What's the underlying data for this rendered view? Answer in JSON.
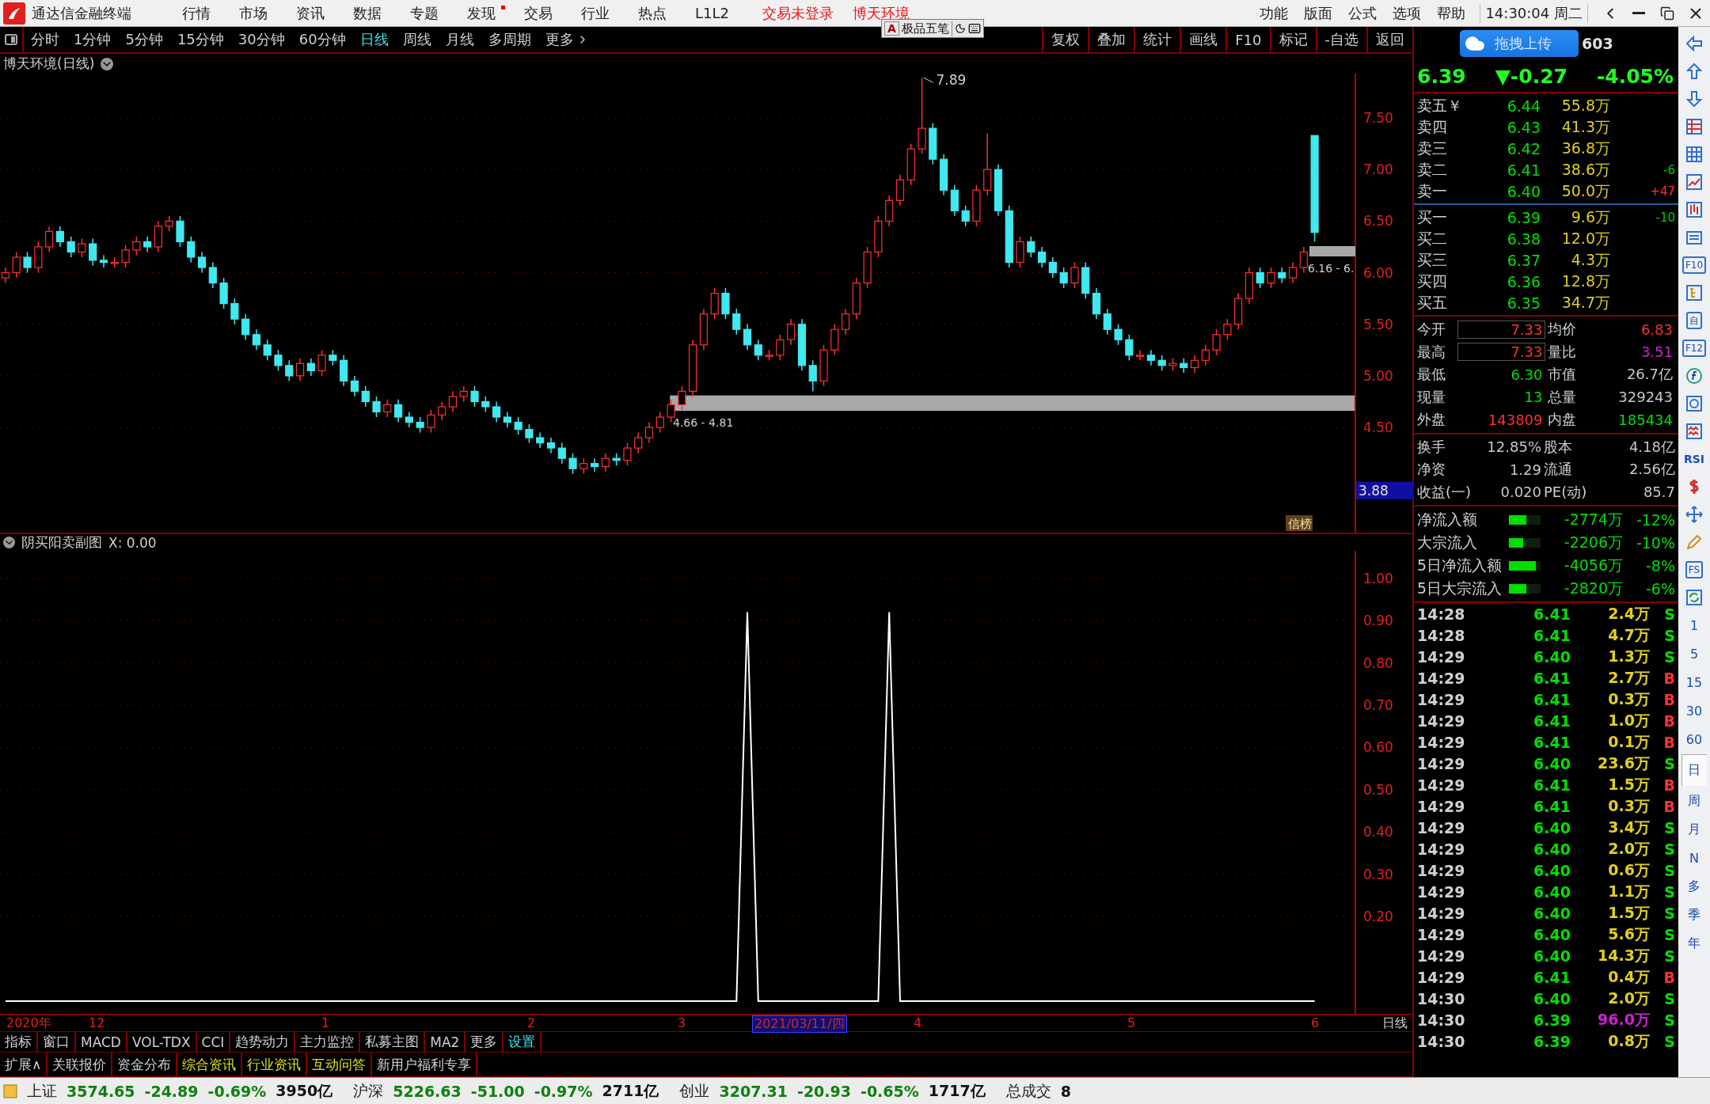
{
  "app": {
    "title": "通达信金融终端",
    "menu": [
      {
        "label": "行情",
        "dot": false
      },
      {
        "label": "市场",
        "dot": false
      },
      {
        "label": "资讯",
        "dot": false
      },
      {
        "label": "数据",
        "dot": false
      },
      {
        "label": "专题",
        "dot": false
      },
      {
        "label": "发现",
        "dot": true
      },
      {
        "label": "交易",
        "dot": false
      },
      {
        "label": "行业",
        "dot": false
      },
      {
        "label": "热点",
        "dot": false
      },
      {
        "label": "L1L2",
        "dot": false
      }
    ],
    "notices": [
      "交易未登录",
      "博天环境"
    ],
    "menu_right": [
      "功能",
      "版面",
      "公式",
      "选项",
      "帮助"
    ],
    "clock": "14:30:04 周二"
  },
  "ime_bar": {
    "mode": "A",
    "name": "极品五笔"
  },
  "periods": [
    {
      "label": "分时",
      "selected": false
    },
    {
      "label": "1分钟",
      "selected": false
    },
    {
      "label": "5分钟",
      "selected": false
    },
    {
      "label": "15分钟",
      "selected": false
    },
    {
      "label": "30分钟",
      "selected": false
    },
    {
      "label": "60分钟",
      "selected": false
    },
    {
      "label": "日线",
      "selected": true
    },
    {
      "label": "周线",
      "selected": false
    },
    {
      "label": "月线",
      "selected": false
    },
    {
      "label": "多周期",
      "selected": false
    },
    {
      "label": "更多",
      "selected": false
    }
  ],
  "tools": [
    "复权",
    "叠加",
    "统计",
    "画线",
    "F10",
    "标记",
    "-自选",
    "返回"
  ],
  "chart": {
    "title": "博天环境(日线)",
    "high_label": "7.89",
    "low_label": "3.88",
    "chart_data": {
      "type": "candlestick",
      "ylim": [
        3.48,
        7.93
      ],
      "grid": true,
      "bands": [
        {
          "axis": "y",
          "from": 4.66,
          "to": 4.81,
          "label": "4.66 - 4.81"
        }
      ],
      "yticks": [
        {
          "value": 7.5,
          "label": "7.50"
        },
        {
          "value": 7.0,
          "label": "7.00"
        },
        {
          "value": 6.5,
          "label": "6.50"
        },
        {
          "value": 6.0,
          "label": "6.00"
        },
        {
          "value": 5.5,
          "label": "5.50"
        },
        {
          "value": 5.0,
          "label": "5.00"
        },
        {
          "value": 4.5,
          "label": "4.50"
        }
      ],
      "ohlc": [
        [
          5.95,
          6.05,
          5.9,
          6.0
        ],
        [
          6.0,
          6.2,
          5.95,
          6.15
        ],
        [
          6.15,
          6.2,
          6.0,
          6.05
        ],
        [
          6.05,
          6.3,
          6.0,
          6.25
        ],
        [
          6.25,
          6.45,
          6.2,
          6.4
        ],
        [
          6.4,
          6.45,
          6.25,
          6.3
        ],
        [
          6.3,
          6.35,
          6.15,
          6.2
        ],
        [
          6.2,
          6.33,
          6.15,
          6.28
        ],
        [
          6.28,
          6.33,
          6.07,
          6.12
        ],
        [
          6.12,
          6.17,
          6.05,
          6.1
        ],
        [
          6.1,
          6.15,
          6.05,
          6.1
        ],
        [
          6.1,
          6.27,
          6.05,
          6.22
        ],
        [
          6.22,
          6.35,
          6.17,
          6.3
        ],
        [
          6.3,
          6.35,
          6.2,
          6.25
        ],
        [
          6.25,
          6.5,
          6.2,
          6.45
        ],
        [
          6.45,
          6.55,
          6.4,
          6.5
        ],
        [
          6.5,
          6.55,
          6.25,
          6.3
        ],
        [
          6.3,
          6.35,
          6.1,
          6.15
        ],
        [
          6.15,
          6.2,
          6.0,
          6.05
        ],
        [
          6.05,
          6.1,
          5.85,
          5.9
        ],
        [
          5.9,
          5.95,
          5.65,
          5.7
        ],
        [
          5.7,
          5.75,
          5.5,
          5.55
        ],
        [
          5.55,
          5.6,
          5.35,
          5.4
        ],
        [
          5.4,
          5.45,
          5.25,
          5.3
        ],
        [
          5.3,
          5.35,
          5.15,
          5.2
        ],
        [
          5.2,
          5.25,
          5.05,
          5.1
        ],
        [
          5.1,
          5.15,
          4.95,
          5.0
        ],
        [
          5.0,
          5.17,
          4.95,
          5.12
        ],
        [
          5.12,
          5.17,
          5.0,
          5.05
        ],
        [
          5.05,
          5.25,
          5.0,
          5.2
        ],
        [
          5.2,
          5.25,
          5.1,
          5.15
        ],
        [
          5.15,
          5.2,
          4.9,
          4.95
        ],
        [
          4.95,
          5.0,
          4.8,
          4.85
        ],
        [
          4.85,
          4.9,
          4.7,
          4.75
        ],
        [
          4.75,
          4.8,
          4.6,
          4.65
        ],
        [
          4.65,
          4.77,
          4.6,
          4.72
        ],
        [
          4.72,
          4.77,
          4.55,
          4.6
        ],
        [
          4.6,
          4.65,
          4.5,
          4.55
        ],
        [
          4.55,
          4.6,
          4.45,
          4.5
        ],
        [
          4.5,
          4.67,
          4.45,
          4.62
        ],
        [
          4.62,
          4.75,
          4.57,
          4.7
        ],
        [
          4.7,
          4.85,
          4.65,
          4.8
        ],
        [
          4.8,
          4.9,
          4.75,
          4.85
        ],
        [
          4.85,
          4.9,
          4.7,
          4.75
        ],
        [
          4.75,
          4.8,
          4.65,
          4.7
        ],
        [
          4.7,
          4.75,
          4.55,
          4.6
        ],
        [
          4.6,
          4.65,
          4.5,
          4.55
        ],
        [
          4.55,
          4.6,
          4.43,
          4.48
        ],
        [
          4.48,
          4.53,
          4.35,
          4.4
        ],
        [
          4.4,
          4.45,
          4.3,
          4.35
        ],
        [
          4.35,
          4.4,
          4.25,
          4.3
        ],
        [
          4.3,
          4.35,
          4.15,
          4.2
        ],
        [
          4.2,
          4.25,
          4.05,
          4.1
        ],
        [
          4.1,
          4.2,
          4.05,
          4.15
        ],
        [
          4.15,
          4.2,
          4.07,
          4.12
        ],
        [
          4.12,
          4.25,
          4.07,
          4.2
        ],
        [
          4.2,
          4.25,
          4.13,
          4.18
        ],
        [
          4.18,
          4.35,
          4.13,
          4.3
        ],
        [
          4.3,
          4.45,
          4.25,
          4.4
        ],
        [
          4.4,
          4.55,
          4.35,
          4.5
        ],
        [
          4.5,
          4.65,
          4.45,
          4.6
        ],
        [
          4.6,
          4.77,
          4.55,
          4.72
        ],
        [
          4.72,
          4.9,
          4.67,
          4.85
        ],
        [
          4.85,
          5.35,
          4.8,
          5.3
        ],
        [
          5.3,
          5.65,
          5.25,
          5.6
        ],
        [
          5.6,
          5.85,
          5.55,
          5.8
        ],
        [
          5.8,
          5.85,
          5.55,
          5.6
        ],
        [
          5.6,
          5.65,
          5.4,
          5.45
        ],
        [
          5.45,
          5.5,
          5.25,
          5.3
        ],
        [
          5.3,
          5.35,
          5.15,
          5.2
        ],
        [
          5.2,
          5.25,
          5.15,
          5.2
        ],
        [
          5.2,
          5.4,
          5.15,
          5.35
        ],
        [
          5.35,
          5.55,
          5.3,
          5.5
        ],
        [
          5.5,
          5.55,
          5.05,
          5.1
        ],
        [
          5.1,
          5.15,
          4.85,
          4.95
        ],
        [
          4.95,
          5.3,
          4.9,
          5.25
        ],
        [
          5.25,
          5.5,
          5.2,
          5.45
        ],
        [
          5.45,
          5.65,
          5.4,
          5.6
        ],
        [
          5.6,
          5.95,
          5.55,
          5.9
        ],
        [
          5.9,
          6.25,
          5.85,
          6.2
        ],
        [
          6.2,
          6.55,
          6.15,
          6.5
        ],
        [
          6.5,
          6.75,
          6.45,
          6.7
        ],
        [
          6.7,
          6.95,
          6.65,
          6.9
        ],
        [
          6.9,
          7.25,
          6.85,
          7.2
        ],
        [
          7.2,
          7.89,
          7.15,
          7.4
        ],
        [
          7.4,
          7.45,
          7.05,
          7.1
        ],
        [
          7.1,
          7.15,
          6.75,
          6.8
        ],
        [
          6.8,
          6.85,
          6.55,
          6.6
        ],
        [
          6.6,
          6.65,
          6.45,
          6.5
        ],
        [
          6.5,
          6.85,
          6.45,
          6.8
        ],
        [
          6.8,
          7.35,
          6.75,
          7.0
        ],
        [
          7.0,
          7.05,
          6.55,
          6.6
        ],
        [
          6.6,
          6.65,
          6.05,
          6.1
        ],
        [
          6.1,
          6.35,
          6.05,
          6.3
        ],
        [
          6.3,
          6.35,
          6.15,
          6.2
        ],
        [
          6.2,
          6.25,
          6.05,
          6.1
        ],
        [
          6.1,
          6.15,
          5.95,
          6.0
        ],
        [
          6.0,
          6.05,
          5.85,
          5.9
        ],
        [
          5.9,
          6.1,
          5.85,
          6.05
        ],
        [
          6.05,
          6.1,
          5.75,
          5.8
        ],
        [
          5.8,
          5.85,
          5.55,
          5.6
        ],
        [
          5.6,
          5.65,
          5.4,
          5.45
        ],
        [
          5.45,
          5.5,
          5.3,
          5.35
        ],
        [
          5.35,
          5.4,
          5.15,
          5.2
        ],
        [
          5.2,
          5.25,
          5.15,
          5.2
        ],
        [
          5.2,
          5.25,
          5.1,
          5.15
        ],
        [
          5.15,
          5.2,
          5.05,
          5.1
        ],
        [
          5.1,
          5.17,
          5.05,
          5.12
        ],
        [
          5.12,
          5.17,
          5.03,
          5.08
        ],
        [
          5.08,
          5.2,
          5.03,
          5.15
        ],
        [
          5.15,
          5.3,
          5.1,
          5.25
        ],
        [
          5.25,
          5.45,
          5.2,
          5.4
        ],
        [
          5.4,
          5.55,
          5.35,
          5.5
        ],
        [
          5.5,
          5.8,
          5.45,
          5.75
        ],
        [
          5.75,
          6.05,
          5.7,
          6.0
        ],
        [
          6.0,
          6.05,
          5.85,
          5.9
        ],
        [
          5.9,
          6.05,
          5.85,
          6.0
        ],
        [
          6.0,
          6.05,
          5.9,
          5.95
        ],
        [
          5.95,
          6.1,
          5.9,
          6.05
        ],
        [
          6.05,
          6.25,
          6.0,
          6.2
        ],
        [
          7.33,
          7.33,
          6.3,
          6.39
        ]
      ]
    },
    "badge": "信榜",
    "range_label": "6.16 - 6."
  },
  "subchart": {
    "title": "阴买阳卖副图",
    "reading": ": 0.00",
    "chart_data": {
      "type": "line",
      "ylim": [
        -0.03,
        1.065
      ],
      "grid": true,
      "yticks": [
        {
          "value": 0.2,
          "label": "0.20"
        },
        {
          "value": 0.3,
          "label": "0.30"
        },
        {
          "value": 0.4,
          "label": "0.40"
        },
        {
          "value": 0.5,
          "label": "0.50"
        },
        {
          "value": 0.6,
          "label": "0.60"
        },
        {
          "value": 0.7,
          "label": "0.70"
        },
        {
          "value": 0.8,
          "label": "0.80"
        },
        {
          "value": 0.9,
          "label": "0.90"
        },
        {
          "value": 1.0,
          "label": "1.00"
        }
      ],
      "series": [
        {
          "name": "X",
          "color": "#ffffff",
          "values": [
            0,
            0,
            0,
            0,
            0,
            0,
            0,
            0,
            0,
            0,
            0,
            0,
            0,
            0,
            0,
            0,
            0,
            0,
            0,
            0,
            0,
            0,
            0,
            0,
            0,
            0,
            0,
            0,
            0,
            0,
            0,
            0,
            0,
            0,
            0,
            0,
            0,
            0,
            0,
            0,
            0,
            0,
            0,
            0,
            0,
            0,
            0,
            0,
            0,
            0,
            0,
            0,
            0,
            0,
            0,
            0,
            0,
            0,
            0,
            0,
            0,
            0,
            0,
            0,
            0,
            0,
            0,
            0,
            0.92,
            0,
            0,
            0,
            0,
            0,
            0,
            0,
            0,
            0,
            0,
            0,
            0,
            0.92,
            0,
            0,
            0,
            0,
            0,
            0,
            0,
            0,
            0,
            0,
            0,
            0,
            0,
            0,
            0,
            0,
            0,
            0,
            0,
            0,
            0,
            0,
            0,
            0,
            0,
            0,
            0,
            0,
            0,
            0,
            0,
            0,
            0,
            0,
            0,
            0,
            0,
            0,
            0
          ]
        }
      ]
    }
  },
  "date_axis": {
    "labels": [
      {
        "label": "2020年",
        "selected": false
      },
      {
        "label": "12",
        "selected": false
      },
      {
        "label": "1",
        "selected": false
      },
      {
        "label": "2",
        "selected": false
      },
      {
        "label": "3",
        "selected": false
      },
      {
        "label": "2021/03/11/四",
        "selected": true
      },
      {
        "label": "4",
        "selected": false
      },
      {
        "label": "5",
        "selected": false
      },
      {
        "label": "6",
        "selected": false
      }
    ],
    "period": "日线"
  },
  "indicator_tabs": [
    {
      "label": "指标",
      "selected": false
    },
    {
      "label": "窗口",
      "selected": false
    },
    {
      "label": "MACD",
      "selected": false
    },
    {
      "label": "VOL-TDX",
      "selected": false
    },
    {
      "label": "CCI",
      "selected": false
    },
    {
      "label": "趋势动力",
      "selected": false
    },
    {
      "label": "主力监控",
      "selected": false
    },
    {
      "label": "私募主图",
      "selected": false
    },
    {
      "label": "MA2",
      "selected": false
    },
    {
      "label": "更多",
      "selected": false
    },
    {
      "label": "设置",
      "selected": true
    }
  ],
  "info_tabs": [
    {
      "label": "扩展∧",
      "highlighted": false
    },
    {
      "label": "关联报价",
      "highlighted": false
    },
    {
      "label": "资金分布",
      "highlighted": false
    },
    {
      "label": "综合资讯",
      "highlighted": true
    },
    {
      "label": "行业资讯",
      "highlighted": true
    },
    {
      "label": "互动问答",
      "highlighted": true
    },
    {
      "label": "新用户福利专享",
      "highlighted": false
    }
  ],
  "quote": {
    "upload": "拖拽上传",
    "code_fragment": "603",
    "price": "6.39",
    "change": "▼-0.27",
    "pct": "-4.05%",
    "sells": [
      {
        "label": "卖五",
        "tag": "￥",
        "price": "6.44",
        "volume": "55.8万"
      },
      {
        "label": "卖四",
        "price": "6.43",
        "volume": "41.3万"
      },
      {
        "label": "卖三",
        "price": "6.42",
        "volume": "36.8万"
      },
      {
        "label": "卖二",
        "price": "6.41",
        "volume": "38.6万",
        "delta": "-6",
        "color": "#00d000"
      },
      {
        "label": "卖一",
        "price": "6.40",
        "volume": "50.0万",
        "delta": "+47",
        "color": "#ff3030"
      }
    ],
    "buys": [
      {
        "label": "买一",
        "price": "6.39",
        "volume": "9.6万",
        "delta": "-10",
        "color": "#00d000"
      },
      {
        "label": "买二",
        "price": "6.38",
        "volume": "12.0万"
      },
      {
        "label": "买三",
        "price": "6.37",
        "volume": "4.3万"
      },
      {
        "label": "买四",
        "price": "6.36",
        "volume": "12.8万"
      },
      {
        "label": "买五",
        "price": "6.35",
        "volume": "34.7万"
      }
    ],
    "stats": [
      [
        {
          "label": "今开",
          "value": "7.33",
          "color": "#ff3030",
          "boxed": true
        },
        {
          "label": "均价",
          "value": "6.83",
          "color": "#ff3030",
          "boxed": false
        }
      ],
      [
        {
          "label": "最高",
          "value": "7.33",
          "color": "#ff3030",
          "boxed": true
        },
        {
          "label": "量比",
          "value": "3.51",
          "color": "#d020d0",
          "boxed": false
        }
      ],
      [
        {
          "label": "最低",
          "value": "6.30",
          "color": "#00e000",
          "boxed": false
        },
        {
          "label": "市值",
          "value": "26.7亿",
          "color": "#c8c8c8",
          "boxed": false
        }
      ],
      [
        {
          "label": "现量",
          "value": "13",
          "color": "#00e000",
          "boxed": false
        },
        {
          "label": "总量",
          "value": "329243",
          "color": "#c8c8c8",
          "boxed": false
        }
      ],
      [
        {
          "label": "外盘",
          "value": "143809",
          "color": "#ff3030",
          "boxed": false
        },
        {
          "label": "内盘",
          "value": "185434",
          "color": "#00e000",
          "boxed": false
        }
      ]
    ],
    "fundamentals": [
      [
        {
          "label": "换手",
          "value": "12.85%"
        },
        {
          "label": "股本",
          "value": "4.18亿"
        }
      ],
      [
        {
          "label": "净资",
          "value": "1.29"
        },
        {
          "label": "流通",
          "value": "2.56亿"
        }
      ],
      [
        {
          "label": "收益(一)",
          "value": "0.020"
        },
        {
          "label": "PE(动)",
          "value": "85.7"
        }
      ]
    ],
    "flows": [
      {
        "label": "净流入额",
        "level": 0.55,
        "amount": "-2774万",
        "pct": "-12%"
      },
      {
        "label": "大宗流入",
        "level": 0.45,
        "amount": "-2206万",
        "pct": "-10%"
      },
      {
        "label": "5日净流入额",
        "level": 0.85,
        "amount": "-4056万",
        "pct": "-8%"
      },
      {
        "label": "5日大宗流入",
        "level": 0.55,
        "amount": "-2820万",
        "pct": "-6%"
      }
    ],
    "ticks": [
      {
        "time": "14:28",
        "price": "6.41",
        "volume": "2.4万",
        "side": "S",
        "buy": false,
        "large": false
      },
      {
        "time": "14:28",
        "price": "6.41",
        "volume": "4.7万",
        "side": "S",
        "buy": false,
        "large": false
      },
      {
        "time": "14:29",
        "price": "6.40",
        "volume": "1.3万",
        "side": "S",
        "buy": false,
        "large": false
      },
      {
        "time": "14:29",
        "price": "6.41",
        "volume": "2.7万",
        "side": "B",
        "buy": true,
        "large": false
      },
      {
        "time": "14:29",
        "price": "6.41",
        "volume": "0.3万",
        "side": "B",
        "buy": true,
        "large": false
      },
      {
        "time": "14:29",
        "price": "6.41",
        "volume": "1.0万",
        "side": "B",
        "buy": true,
        "large": false
      },
      {
        "time": "14:29",
        "price": "6.41",
        "volume": "0.1万",
        "side": "B",
        "buy": true,
        "large": false
      },
      {
        "time": "14:29",
        "price": "6.40",
        "volume": "23.6万",
        "side": "S",
        "buy": false,
        "large": false
      },
      {
        "time": "14:29",
        "price": "6.41",
        "volume": "1.5万",
        "side": "B",
        "buy": true,
        "large": false
      },
      {
        "time": "14:29",
        "price": "6.41",
        "volume": "0.3万",
        "side": "B",
        "buy": true,
        "large": false
      },
      {
        "time": "14:29",
        "price": "6.40",
        "volume": "3.4万",
        "side": "S",
        "buy": false,
        "large": false
      },
      {
        "time": "14:29",
        "price": "6.40",
        "volume": "2.0万",
        "side": "S",
        "buy": false,
        "large": false
      },
      {
        "time": "14:29",
        "price": "6.40",
        "volume": "0.6万",
        "side": "S",
        "buy": false,
        "large": false
      },
      {
        "time": "14:29",
        "price": "6.40",
        "volume": "1.1万",
        "side": "S",
        "buy": false,
        "large": false
      },
      {
        "time": "14:29",
        "price": "6.40",
        "volume": "1.5万",
        "side": "S",
        "buy": false,
        "large": false
      },
      {
        "time": "14:29",
        "price": "6.40",
        "volume": "5.6万",
        "side": "S",
        "buy": false,
        "large": false
      },
      {
        "time": "14:29",
        "price": "6.40",
        "volume": "14.3万",
        "side": "S",
        "buy": false,
        "large": false
      },
      {
        "time": "14:29",
        "price": "6.41",
        "volume": "0.4万",
        "side": "B",
        "buy": true,
        "large": false
      },
      {
        "time": "14:30",
        "price": "6.40",
        "volume": "2.0万",
        "side": "S",
        "buy": false,
        "large": false
      },
      {
        "time": "14:30",
        "price": "6.39",
        "volume": "96.0万",
        "side": "S",
        "buy": false,
        "large": true
      },
      {
        "time": "14:30",
        "price": "6.39",
        "volume": "0.8万",
        "side": "S",
        "buy": false,
        "large": false
      }
    ]
  },
  "icon_strip": [
    {
      "kind": "arrow-left"
    },
    {
      "kind": "arrow-up"
    },
    {
      "kind": "arrow-down"
    },
    {
      "kind": "table"
    },
    {
      "kind": "grid"
    },
    {
      "kind": "line-chart"
    },
    {
      "kind": "candles"
    },
    {
      "kind": "list"
    },
    {
      "kind": "label",
      "label": "F10"
    },
    {
      "kind": "tree"
    },
    {
      "kind": "label",
      "label": "自"
    },
    {
      "kind": "label",
      "label": "F12"
    },
    {
      "kind": "function"
    },
    {
      "kind": "circle"
    },
    {
      "kind": "wave"
    },
    {
      "kind": "text",
      "label": "RSI"
    },
    {
      "kind": "dollar"
    },
    {
      "kind": "move"
    },
    {
      "kind": "pencil"
    },
    {
      "kind": "label",
      "label": "FS"
    },
    {
      "kind": "refresh"
    },
    {
      "kind": "period",
      "label": "1",
      "selected": false
    },
    {
      "kind": "period",
      "label": "5",
      "selected": false
    },
    {
      "kind": "period",
      "label": "15",
      "selected": false
    },
    {
      "kind": "period",
      "label": "30",
      "selected": false
    },
    {
      "kind": "period",
      "label": "60",
      "selected": false
    },
    {
      "kind": "period",
      "label": "日",
      "selected": true
    },
    {
      "kind": "period",
      "label": "周",
      "selected": false
    },
    {
      "kind": "period",
      "label": "月",
      "selected": false
    },
    {
      "kind": "period",
      "label": "N",
      "selected": false
    },
    {
      "kind": "period",
      "label": "多",
      "selected": false
    },
    {
      "kind": "period",
      "label": "季",
      "selected": false
    },
    {
      "kind": "period",
      "label": "年",
      "selected": false
    }
  ],
  "status_bar": {
    "indices": [
      {
        "name": "上证",
        "price": "3574.65",
        "change": "-24.89",
        "pct": "-0.69%",
        "turnover": "3950亿"
      },
      {
        "name": "沪深",
        "price": "5226.63",
        "change": "-51.00",
        "pct": "-0.97%",
        "turnover": "2711亿"
      },
      {
        "name": "创业",
        "price": "3207.31",
        "change": "-20.93",
        "pct": "-0.65%",
        "turnover": "1717亿"
      }
    ],
    "total_label": "总成交",
    "total_value": "8"
  }
}
